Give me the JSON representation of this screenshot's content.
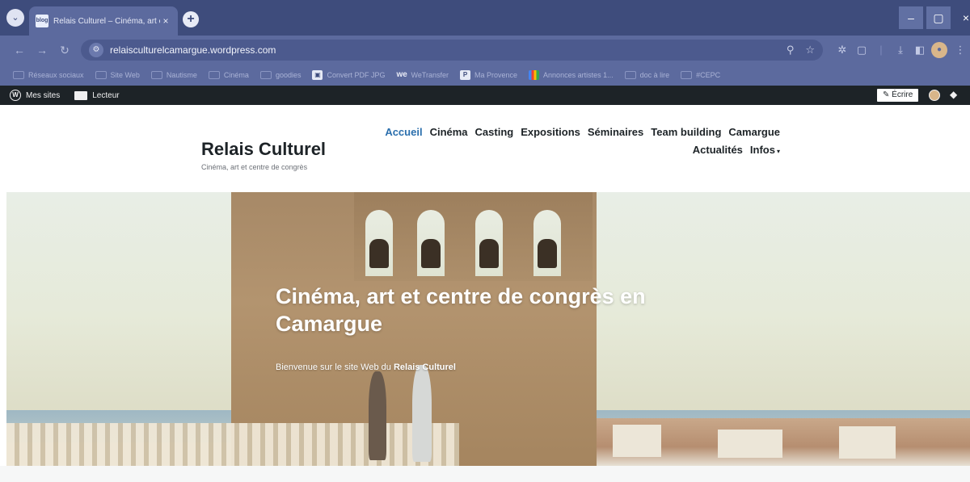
{
  "browser": {
    "tab_title": "Relais Culturel – Cinéma, art et",
    "tab_favicon": "blog",
    "tab_close": "×",
    "new_tab": "+",
    "url": "relaisculturelcamargue.wordpress.com",
    "window_controls": {
      "minimize": "–",
      "maximize": "▢",
      "close": "×"
    },
    "icons": [
      "tab-search-icon",
      "back-icon",
      "forward-icon",
      "reload-icon",
      "site-info-icon",
      "zoom-icon",
      "star-icon",
      "extensions-icon",
      "download-icon",
      "sidepanel-icon",
      "profile-icon"
    ]
  },
  "bookmarks": [
    {
      "label": "Réseaux sociaux",
      "icon": "folder"
    },
    {
      "label": "Site Web",
      "icon": "folder"
    },
    {
      "label": "Nautisme",
      "icon": "folder"
    },
    {
      "label": "Cinéma",
      "icon": "folder"
    },
    {
      "label": "goodies",
      "icon": "folder"
    },
    {
      "label": "Convert PDF JPG",
      "icon": "app"
    },
    {
      "label": "WeTransfer",
      "icon": "we"
    },
    {
      "label": "Ma Provence",
      "icon": "P"
    },
    {
      "label": "Annonces artistes 1...",
      "icon": "multi"
    },
    {
      "label": "doc à lire",
      "icon": "folder"
    },
    {
      "label": "#CEPC",
      "icon": "folder"
    }
  ],
  "wp_admin_bar": {
    "my_sites": "Mes sites",
    "reader": "Lecteur",
    "write": "Écrire"
  },
  "site": {
    "title": "Relais Culturel",
    "tagline": "Cinéma, art et centre de congrès",
    "nav": [
      "Accueil",
      "Cinéma",
      "Casting",
      "Expositions",
      "Séminaires",
      "Team building",
      "Camargue",
      "Actualités",
      "Infos"
    ],
    "active_nav": "Accueil",
    "accent_color": "#2b6fad"
  },
  "hero": {
    "heading": "Cinéma, art et centre de congrès en Camargue",
    "text_prefix": "Bienvenue sur le site Web du ",
    "text_bold": "Relais Culturel"
  }
}
